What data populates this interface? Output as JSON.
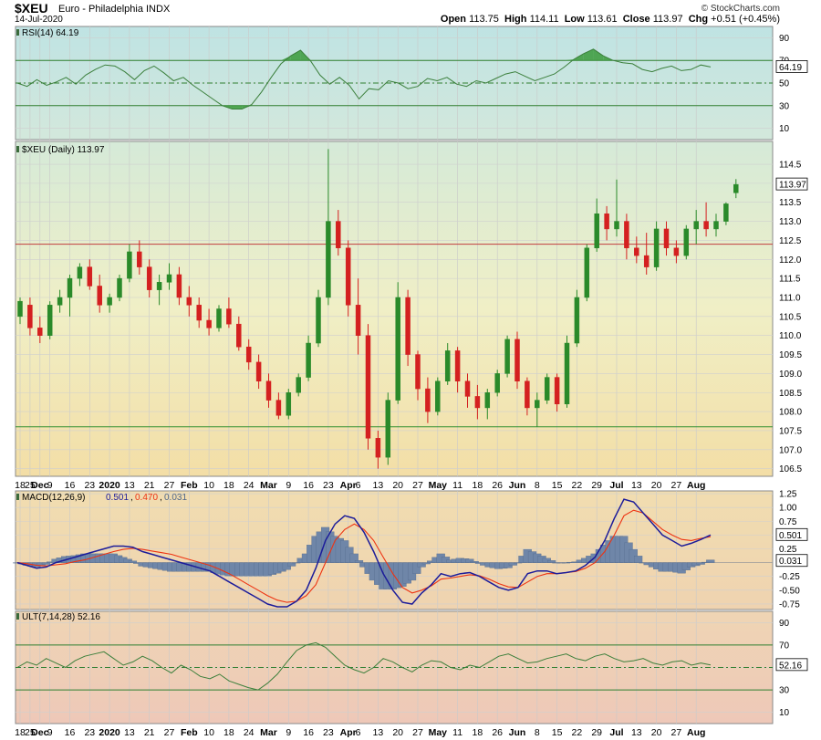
{
  "header": {
    "symbol": "$XEU",
    "name": "Euro - Philadelphia INDX",
    "date": "14-Jul-2020",
    "copyright": "© StockCharts.com",
    "open_label": "Open",
    "open": "113.75",
    "high_label": "High",
    "high": "114.11",
    "low_label": "Low",
    "low": "113.61",
    "close_label": "Close",
    "close": "113.97",
    "chg_label": "Chg",
    "chg": "+0.51 (+0.45%)"
  },
  "colors": {
    "up": "#2a8a2a",
    "down": "#d42020",
    "rsi_line": "#3b7f3b",
    "macd": "#1c1c9a",
    "signal": "#ee3311",
    "hist": "#6f86a8"
  },
  "chart_data": [
    {
      "type": "line",
      "title": "RSI(14) 64.19",
      "legend": "RSI(14) 64.19",
      "ylim": [
        0,
        100
      ],
      "yticks": [
        10,
        30,
        50,
        70,
        90
      ],
      "levels": [
        30,
        50,
        70
      ],
      "last_label": "64.19",
      "series": [
        {
          "values": [
            50,
            47,
            53,
            48,
            51,
            55,
            49,
            57,
            62,
            66,
            65,
            60,
            53,
            61,
            65,
            59,
            52,
            55,
            48,
            42,
            36,
            30,
            27,
            27,
            31,
            42,
            55,
            67,
            74,
            79,
            70,
            57,
            49,
            55,
            48,
            36,
            45,
            44,
            52,
            50,
            45,
            47,
            54,
            52,
            55,
            49,
            47,
            52,
            50,
            54,
            58,
            60,
            56,
            52,
            55,
            58,
            64,
            71,
            76,
            80,
            74,
            70,
            68,
            67,
            62,
            60,
            63,
            65,
            61,
            62,
            66,
            64.19
          ]
        }
      ]
    },
    {
      "type": "candlestick",
      "title": "$XEU (Daily) 113.97",
      "legend": "$XEU (Daily) 113.97",
      "ylim": [
        106.3,
        115.1
      ],
      "yticks": [
        106.5,
        107.0,
        107.5,
        108.0,
        108.5,
        109.0,
        109.5,
        110.0,
        110.5,
        111.0,
        111.5,
        112.0,
        112.5,
        113.0,
        113.5,
        114.0,
        114.5
      ],
      "levels": [
        112.4,
        107.6
      ],
      "last_label": "113.97",
      "ohlc": [
        [
          110.5,
          111.0,
          110.3,
          110.9
        ],
        [
          110.8,
          111.0,
          110.0,
          110.2
        ],
        [
          110.2,
          110.5,
          109.8,
          110.0
        ],
        [
          110.0,
          110.9,
          109.9,
          110.8
        ],
        [
          110.8,
          111.2,
          110.6,
          111.0
        ],
        [
          111.0,
          111.6,
          110.5,
          111.5
        ],
        [
          111.5,
          111.9,
          111.3,
          111.8
        ],
        [
          111.8,
          112.0,
          111.2,
          111.3
        ],
        [
          111.3,
          111.6,
          110.6,
          110.8
        ],
        [
          110.8,
          111.1,
          110.6,
          111.0
        ],
        [
          111.0,
          111.6,
          110.9,
          111.5
        ],
        [
          111.5,
          112.4,
          111.4,
          112.2
        ],
        [
          112.2,
          112.5,
          111.6,
          111.8
        ],
        [
          111.8,
          112.0,
          111.0,
          111.2
        ],
        [
          111.2,
          111.6,
          110.8,
          111.4
        ],
        [
          111.4,
          111.9,
          111.2,
          111.6
        ],
        [
          111.6,
          111.8,
          110.8,
          111.0
        ],
        [
          111.0,
          111.3,
          110.5,
          110.8
        ],
        [
          110.8,
          111.0,
          110.2,
          110.4
        ],
        [
          110.4,
          110.7,
          110.0,
          110.2
        ],
        [
          110.2,
          110.8,
          110.1,
          110.7
        ],
        [
          110.7,
          111.0,
          110.2,
          110.3
        ],
        [
          110.3,
          110.5,
          109.6,
          109.7
        ],
        [
          109.7,
          109.9,
          109.1,
          109.3
        ],
        [
          109.3,
          109.5,
          108.6,
          108.8
        ],
        [
          108.8,
          109.0,
          108.1,
          108.3
        ],
        [
          108.3,
          108.5,
          107.8,
          107.9
        ],
        [
          107.9,
          108.6,
          107.8,
          108.5
        ],
        [
          108.5,
          109.0,
          108.4,
          108.9
        ],
        [
          108.9,
          110.0,
          108.8,
          109.8
        ],
        [
          109.8,
          111.2,
          109.7,
          111.0
        ],
        [
          111.0,
          114.9,
          110.8,
          113.0
        ],
        [
          113.0,
          113.3,
          112.1,
          112.3
        ],
        [
          112.3,
          112.5,
          110.5,
          110.8
        ],
        [
          110.8,
          111.5,
          109.5,
          110.0
        ],
        [
          110.0,
          110.3,
          107.0,
          107.3
        ],
        [
          107.3,
          107.5,
          106.5,
          106.8
        ],
        [
          106.8,
          108.5,
          106.6,
          108.3
        ],
        [
          108.3,
          111.4,
          108.2,
          111.0
        ],
        [
          111.0,
          111.2,
          109.2,
          109.5
        ],
        [
          109.5,
          109.6,
          108.3,
          108.6
        ],
        [
          108.6,
          108.9,
          107.7,
          108.0
        ],
        [
          108.0,
          108.9,
          107.9,
          108.8
        ],
        [
          108.8,
          109.8,
          108.7,
          109.6
        ],
        [
          109.6,
          109.7,
          108.5,
          108.8
        ],
        [
          108.8,
          109.0,
          108.1,
          108.4
        ],
        [
          108.4,
          108.7,
          107.8,
          108.1
        ],
        [
          108.1,
          108.6,
          107.8,
          108.5
        ],
        [
          108.5,
          109.1,
          108.4,
          109.0
        ],
        [
          109.0,
          110.0,
          108.9,
          109.9
        ],
        [
          109.9,
          110.1,
          108.6,
          108.8
        ],
        [
          108.8,
          108.9,
          107.9,
          108.1
        ],
        [
          108.1,
          108.5,
          107.6,
          108.3
        ],
        [
          108.3,
          109.0,
          108.2,
          108.9
        ],
        [
          108.9,
          109.0,
          108.0,
          108.2
        ],
        [
          108.2,
          110.0,
          108.1,
          109.8
        ],
        [
          109.8,
          111.2,
          109.7,
          111.0
        ],
        [
          111.0,
          112.4,
          110.9,
          112.3
        ],
        [
          112.3,
          113.6,
          112.2,
          113.2
        ],
        [
          113.2,
          113.4,
          112.5,
          112.8
        ],
        [
          112.8,
          114.1,
          112.6,
          113.0
        ],
        [
          113.0,
          113.2,
          112.0,
          112.3
        ],
        [
          112.3,
          112.6,
          111.9,
          112.1
        ],
        [
          112.1,
          112.7,
          111.6,
          111.8
        ],
        [
          111.8,
          113.0,
          111.7,
          112.8
        ],
        [
          112.8,
          113.0,
          112.1,
          112.3
        ],
        [
          112.3,
          112.5,
          111.9,
          112.1
        ],
        [
          112.1,
          112.9,
          112.0,
          112.8
        ],
        [
          112.8,
          113.3,
          112.4,
          113.0
        ],
        [
          113.0,
          113.5,
          112.6,
          112.8
        ],
        [
          112.8,
          113.2,
          112.6,
          113.0
        ],
        [
          113.0,
          113.5,
          112.9,
          113.46
        ],
        [
          113.75,
          114.11,
          113.61,
          113.97
        ]
      ]
    },
    {
      "type": "line",
      "title": "MACD(12,26,9) 0.501, 0.470, 0.031",
      "legend": {
        "macd": "MACD(12,26,9)",
        "macd_value": "0.501",
        "signal_value": "0.470",
        "hist_value": "0.031"
      },
      "ylim": [
        -0.85,
        1.3
      ],
      "yticks": [
        -0.75,
        -0.5,
        -0.25,
        0.25,
        0.5,
        0.75,
        1.0,
        1.25
      ],
      "last_labels": [
        "0.501",
        "0.031"
      ],
      "series": [
        {
          "name": "MACD",
          "values": [
            0.0,
            -0.05,
            -0.1,
            -0.08,
            0.0,
            0.05,
            0.1,
            0.15,
            0.2,
            0.25,
            0.3,
            0.3,
            0.28,
            0.2,
            0.15,
            0.1,
            0.05,
            0.0,
            -0.05,
            -0.1,
            -0.15,
            -0.25,
            -0.35,
            -0.45,
            -0.55,
            -0.65,
            -0.75,
            -0.8,
            -0.8,
            -0.7,
            -0.5,
            -0.1,
            0.4,
            0.7,
            0.85,
            0.8,
            0.55,
            0.2,
            -0.2,
            -0.5,
            -0.72,
            -0.75,
            -0.55,
            -0.4,
            -0.2,
            -0.25,
            -0.2,
            -0.18,
            -0.25,
            -0.35,
            -0.45,
            -0.5,
            -0.45,
            -0.2,
            -0.15,
            -0.15,
            -0.2,
            -0.18,
            -0.15,
            -0.05,
            0.1,
            0.4,
            0.8,
            1.15,
            1.1,
            0.9,
            0.7,
            0.5,
            0.4,
            0.3,
            0.35,
            0.42,
            0.501
          ]
        },
        {
          "name": "Signal",
          "values": [
            0.0,
            -0.02,
            -0.05,
            -0.06,
            -0.04,
            -0.02,
            0.02,
            0.05,
            0.1,
            0.15,
            0.2,
            0.24,
            0.26,
            0.24,
            0.21,
            0.18,
            0.15,
            0.1,
            0.05,
            0.0,
            -0.05,
            -0.12,
            -0.2,
            -0.3,
            -0.4,
            -0.5,
            -0.6,
            -0.68,
            -0.72,
            -0.7,
            -0.6,
            -0.4,
            0.0,
            0.4,
            0.6,
            0.7,
            0.6,
            0.4,
            0.1,
            -0.2,
            -0.45,
            -0.55,
            -0.5,
            -0.42,
            -0.3,
            -0.28,
            -0.25,
            -0.22,
            -0.24,
            -0.3,
            -0.38,
            -0.44,
            -0.45,
            -0.35,
            -0.25,
            -0.2,
            -0.2,
            -0.18,
            -0.16,
            -0.1,
            0.0,
            0.2,
            0.5,
            0.85,
            0.95,
            0.9,
            0.75,
            0.6,
            0.5,
            0.42,
            0.4,
            0.44,
            0.47
          ]
        }
      ]
    },
    {
      "type": "line",
      "title": "ULT(7,14,28) 52.16",
      "legend": "ULT(7,14,28) 52.16",
      "ylim": [
        0,
        100
      ],
      "yticks": [
        10,
        30,
        50,
        70,
        90
      ],
      "levels": [
        30,
        50,
        70
      ],
      "last_label": "52.16",
      "series": [
        {
          "values": [
            50,
            55,
            52,
            58,
            54,
            50,
            56,
            60,
            62,
            64,
            58,
            52,
            55,
            60,
            56,
            50,
            45,
            52,
            48,
            42,
            40,
            44,
            38,
            35,
            32,
            30,
            36,
            44,
            55,
            65,
            70,
            72,
            68,
            60,
            52,
            48,
            45,
            50,
            58,
            55,
            50,
            46,
            52,
            56,
            55,
            50,
            48,
            52,
            50,
            55,
            60,
            62,
            58,
            54,
            55,
            58,
            60,
            62,
            58,
            56,
            60,
            62,
            58,
            55,
            56,
            58,
            54,
            52,
            55,
            56,
            52,
            54,
            52.16
          ]
        }
      ]
    }
  ],
  "x_labels": [
    {
      "i": 0,
      "t": "18"
    },
    {
      "i": 1,
      "t": "25"
    },
    {
      "i": 2,
      "t": "Dec"
    },
    {
      "i": 3,
      "t": "9"
    },
    {
      "i": 5,
      "t": "16"
    },
    {
      "i": 7,
      "t": "23"
    },
    {
      "i": 9,
      "t": "2020"
    },
    {
      "i": 11,
      "t": "13"
    },
    {
      "i": 13,
      "t": "21"
    },
    {
      "i": 15,
      "t": "27"
    },
    {
      "i": 17,
      "t": "Feb"
    },
    {
      "i": 19,
      "t": "10"
    },
    {
      "i": 21,
      "t": "18"
    },
    {
      "i": 23,
      "t": "24"
    },
    {
      "i": 25,
      "t": "Mar"
    },
    {
      "i": 27,
      "t": "9"
    },
    {
      "i": 29,
      "t": "16"
    },
    {
      "i": 31,
      "t": "23"
    },
    {
      "i": 33,
      "t": "Apr"
    },
    {
      "i": 34,
      "t": "6"
    },
    {
      "i": 36,
      "t": "13"
    },
    {
      "i": 38,
      "t": "20"
    },
    {
      "i": 40,
      "t": "27"
    },
    {
      "i": 42,
      "t": "May"
    },
    {
      "i": 44,
      "t": "11"
    },
    {
      "i": 46,
      "t": "18"
    },
    {
      "i": 48,
      "t": "26"
    },
    {
      "i": 50,
      "t": "Jun"
    },
    {
      "i": 52,
      "t": "8"
    },
    {
      "i": 54,
      "t": "15"
    },
    {
      "i": 56,
      "t": "22"
    },
    {
      "i": 58,
      "t": "29"
    },
    {
      "i": 60,
      "t": "Jul"
    },
    {
      "i": 62,
      "t": "13"
    },
    {
      "i": 64,
      "t": "20"
    },
    {
      "i": 66,
      "t": "27"
    },
    {
      "i": 68,
      "t": "Aug"
    }
  ]
}
